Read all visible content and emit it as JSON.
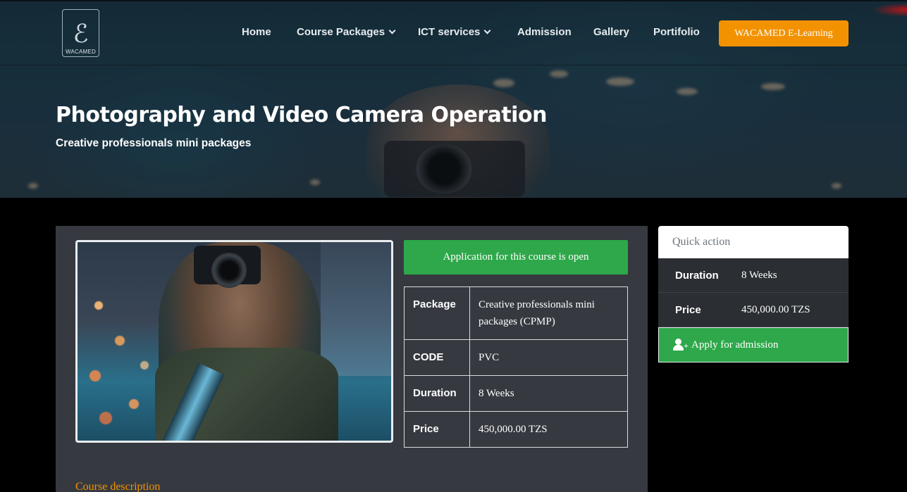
{
  "brand": {
    "logo_text": "WACAMED"
  },
  "nav": {
    "items": [
      {
        "label": "Home"
      },
      {
        "label": "Course Packages"
      },
      {
        "label": "ICT services"
      },
      {
        "label": "Admission"
      },
      {
        "label": "Gallery"
      },
      {
        "label": "Portifolio"
      }
    ],
    "cta_label": "WACAMED E-Learning"
  },
  "hero": {
    "title": "Photography and Video Camera Operation",
    "subtitle": "Creative professionals mini packages"
  },
  "course": {
    "status_banner": "Application for this course is open",
    "details": [
      {
        "key": "Package",
        "value": "Creative professionals mini packages (CPMP)"
      },
      {
        "key": "CODE",
        "value": "PVC"
      },
      {
        "key": "Duration",
        "value": "8 Weeks"
      },
      {
        "key": "Price",
        "value": "450,000.00 TZS"
      }
    ],
    "description_heading": "Course description"
  },
  "quick_action": {
    "title": "Quick action",
    "rows": [
      {
        "key": "Duration",
        "value": "8 Weeks"
      },
      {
        "key": "Price",
        "value": "450,000.00 TZS"
      }
    ],
    "apply_label": "Apply for admission"
  },
  "colors": {
    "accent_orange": "#f39200",
    "success_green": "#2ea84a",
    "panel_dark": "#363a40",
    "page_background": "#000000"
  },
  "icons": [
    "chevron-down-icon",
    "user-plus-icon"
  ]
}
